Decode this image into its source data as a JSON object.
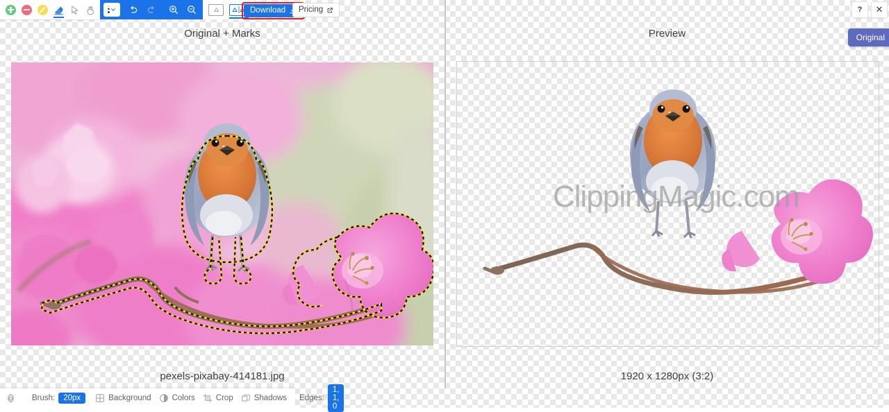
{
  "toolbar": {
    "tools": [
      {
        "id": "add-mark",
        "label": "Add foreground mark",
        "icon": "plus-circle-icon",
        "selected": false
      },
      {
        "id": "remove-mark",
        "label": "Remove background mark",
        "icon": "minus-circle-icon",
        "selected": false
      },
      {
        "id": "hair-mark",
        "label": "Hair mark",
        "icon": "slash-circle-icon",
        "selected": false
      },
      {
        "id": "eraser",
        "label": "Eraser",
        "icon": "eraser-icon",
        "selected": true
      },
      {
        "id": "pointer",
        "label": "Pointer",
        "icon": "cursor-icon",
        "selected": false
      },
      {
        "id": "pan",
        "label": "Pan",
        "icon": "hand-icon",
        "selected": false
      }
    ],
    "brush_size_control": "brush-size-dropdown",
    "undo_label": "Undo",
    "redo_label": "Redo",
    "zoom_in_label": "Zoom in",
    "zoom_out_label": "Zoom out",
    "fit_label": "Fit to screen",
    "view_single_label": "Single view",
    "view_split_label": "Split view",
    "download_label": "Download",
    "pricing_label": "Pricing",
    "help_label": "?",
    "close_label": "✕",
    "original_label": "Original",
    "highlight_color": "#e8191f",
    "accent_color": "#1a73e8"
  },
  "left_pane": {
    "title": "Original + Marks",
    "caption": "pexels-pixabay-414181.jpg"
  },
  "right_pane": {
    "title": "Preview",
    "caption": "1920 x 1280px (3:2)",
    "watermark": "ClippingMagic.com"
  },
  "bottombar": {
    "settings_icon": "gear-icon",
    "brush_label": "Brush:",
    "brush_value": "20px",
    "items": [
      {
        "label": "Background",
        "icon": "grid-icon"
      },
      {
        "label": "Colors",
        "icon": "contrast-circle-icon"
      },
      {
        "label": "Crop",
        "icon": "crop-icon"
      },
      {
        "label": "Shadows",
        "icon": "layers-icon"
      }
    ],
    "edges_label": "Edges:",
    "edges_value": "1, 1, 0"
  }
}
